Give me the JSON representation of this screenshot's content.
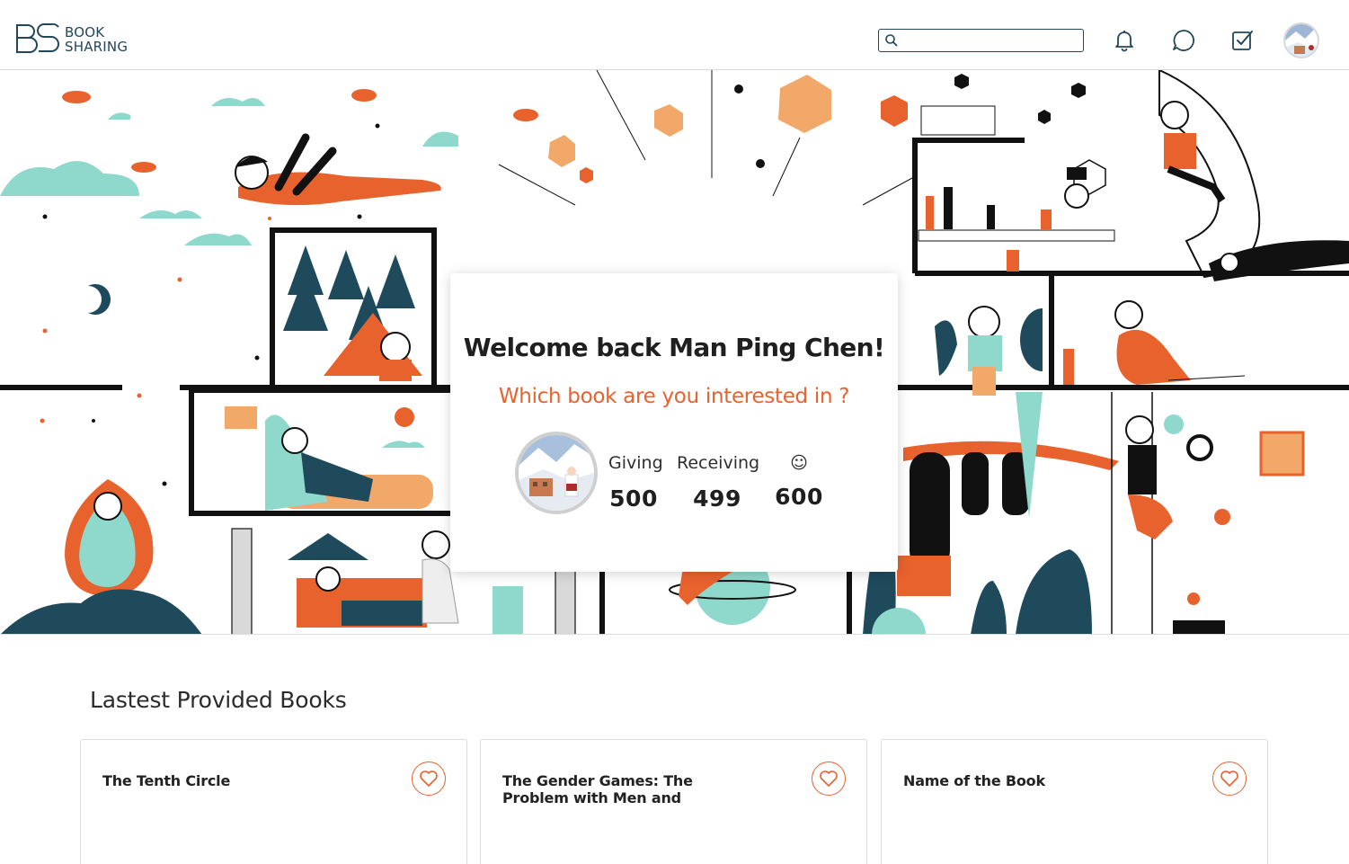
{
  "header": {
    "logo": {
      "text_line1": "BOOK",
      "text_line2": "SHARING",
      "icon": "bs-logo-icon"
    },
    "search": {
      "value": "",
      "placeholder": "",
      "icon": "search-icon"
    },
    "icons": [
      "bell-icon",
      "chat-icon",
      "checkbox-icon"
    ],
    "avatar": "user-avatar"
  },
  "welcome": {
    "title": "Welcome back Man Ping Chen!",
    "subtitle": "Which book are you interested in ?",
    "stats": [
      {
        "label": "Giving",
        "value": "500"
      },
      {
        "label": "Receiving",
        "value": "499"
      },
      {
        "label": "☺",
        "value": "600"
      }
    ]
  },
  "section": {
    "title": "Lastest Provided Books",
    "books": [
      {
        "title": "The Tenth Circle"
      },
      {
        "title": "The Gender Games: The Problem with Men and"
      },
      {
        "title": "Name of the Book"
      }
    ]
  },
  "colors": {
    "accent_orange": "#e8622d",
    "light_orange": "#f2a868",
    "teal": "#8fd8cc",
    "dark_teal": "#1e4a5c",
    "navy_text": "#23475a"
  }
}
